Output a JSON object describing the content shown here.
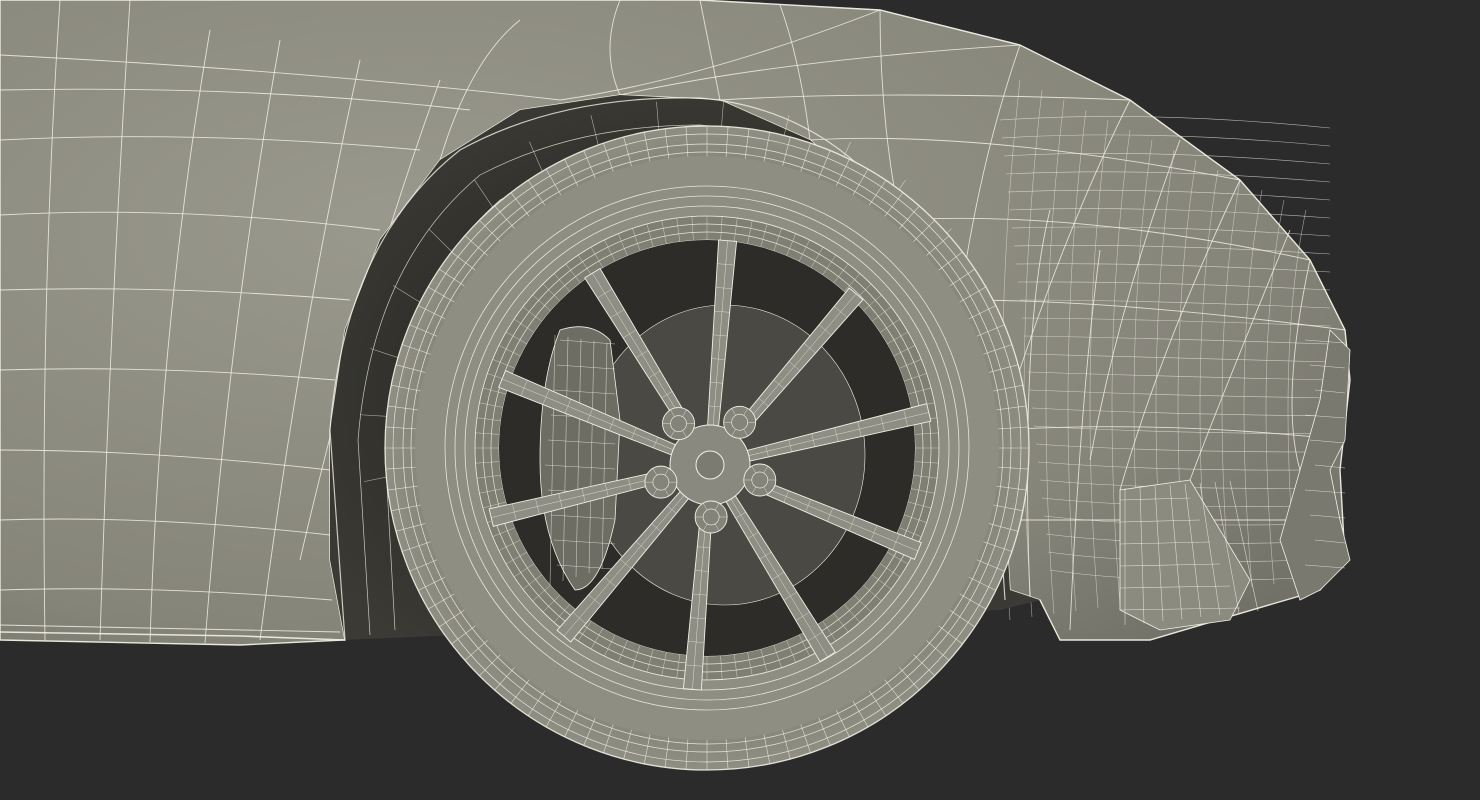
{
  "scene": {
    "background_color": "#2b2b2b",
    "body_color": "#8e8d82",
    "body_shadow_color": "#5c5b53",
    "wire_color": "#f2f0e4",
    "interior_color": "#3a3a36",
    "rotor_color": "#4a4944",
    "spoke_count": 10,
    "lug_nut_count": 5,
    "icons": [
      "car-body-mesh",
      "wheel-arch-mesh",
      "tire-mesh",
      "rim-mesh",
      "brake-rotor",
      "brake-caliper",
      "front-bumper-mesh"
    ]
  }
}
